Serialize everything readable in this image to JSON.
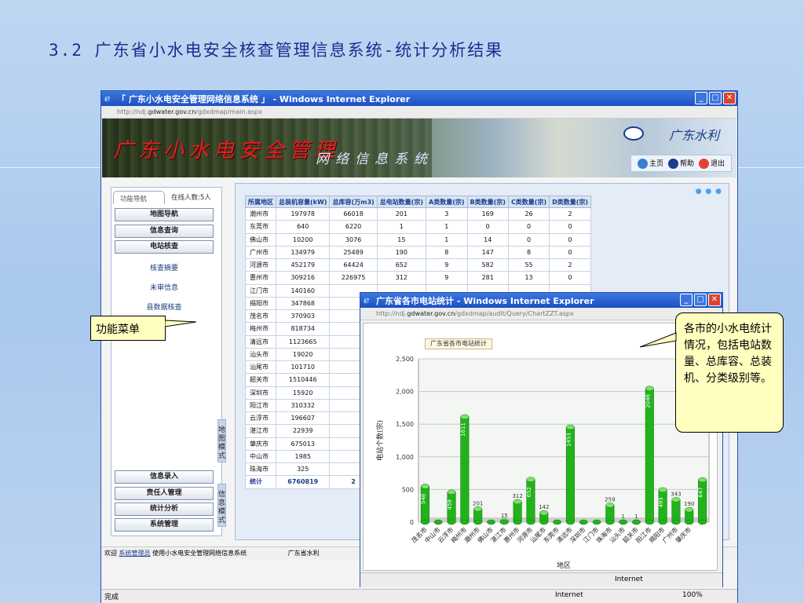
{
  "slide": {
    "title": "3.2 广东省小水电安全核查管理信息系统-统计分析结果"
  },
  "browser": {
    "title": "「 广东小水电安全管理网络信息系统 」 - Windows Internet Explorer",
    "url_prefix": "http://ndj.",
    "url_host": "gdwater.gov.cn",
    "url_path": "/gdxdmap/main.aspx",
    "status_left": "完成",
    "zone": "Internet",
    "zoom": "100%"
  },
  "banner": {
    "title": "广东小水电安全管理",
    "subtitle": "网络信息系统",
    "brand": "广东水利"
  },
  "topnav": {
    "home": "主页",
    "help": "帮助",
    "logout": "退出"
  },
  "sidebar": {
    "tab_nav": "功能导航",
    "online": "在线人数:5人",
    "top_buttons": [
      "地图导航",
      "信息查询",
      "电站核查"
    ],
    "sub_items": [
      "核查摘要",
      "未审信息",
      "县数据核查"
    ],
    "bottom_buttons": [
      "信息录入",
      "责任人管理",
      "统计分析",
      "系统管理"
    ],
    "vtab_map": "地图模式",
    "vtab_info": "信息模式"
  },
  "table": {
    "headers": [
      "所属地区",
      "总装机容量(kW)",
      "总库容(万m3)",
      "总电站数量(宗)",
      "A类数量(宗)",
      "B类数量(宗)",
      "C类数量(宗)",
      "D类数量(宗)"
    ],
    "rows": [
      [
        "潮州市",
        "197978",
        "66018",
        "201",
        "3",
        "169",
        "26",
        "2"
      ],
      [
        "东莞市",
        "640",
        "6220",
        "1",
        "1",
        "0",
        "0",
        "0"
      ],
      [
        "佛山市",
        "10200",
        "3076",
        "15",
        "1",
        "14",
        "0",
        "0"
      ],
      [
        "广州市",
        "134979",
        "25489",
        "190",
        "8",
        "147",
        "8",
        "0"
      ],
      [
        "河源市",
        "452179",
        "64424",
        "652",
        "9",
        "582",
        "55",
        "2"
      ],
      [
        "惠州市",
        "309216",
        "226975",
        "312",
        "9",
        "281",
        "13",
        "0"
      ],
      [
        "江门市",
        "140160",
        "",
        "",
        "",
        "",
        "",
        ""
      ],
      [
        "揭阳市",
        "347868",
        "",
        "",
        "",
        "",
        "",
        ""
      ],
      [
        "茂名市",
        "370903",
        "",
        "",
        "",
        "",
        "",
        ""
      ],
      [
        "梅州市",
        "818734",
        "",
        "",
        "",
        "",
        "",
        ""
      ],
      [
        "清远市",
        "1123665",
        "",
        "",
        "",
        "",
        "",
        ""
      ],
      [
        "汕头市",
        "19020",
        "",
        "",
        "",
        "",
        "",
        ""
      ],
      [
        "汕尾市",
        "101710",
        "",
        "",
        "",
        "",
        "",
        ""
      ],
      [
        "韶关市",
        "1510446",
        "",
        "",
        "",
        "",
        "",
        ""
      ],
      [
        "深圳市",
        "15920",
        "",
        "",
        "",
        "",
        "",
        ""
      ],
      [
        "阳江市",
        "310332",
        "",
        "",
        "",
        "",
        "",
        ""
      ],
      [
        "云浮市",
        "196607",
        "",
        "",
        "",
        "",
        "",
        ""
      ],
      [
        "湛江市",
        "22939",
        "",
        "",
        "",
        "",
        "",
        ""
      ],
      [
        "肇庆市",
        "675013",
        "",
        "",
        "",
        "",
        "",
        ""
      ],
      [
        "中山市",
        "1985",
        "",
        "",
        "",
        "",
        "",
        ""
      ],
      [
        "珠海市",
        "325",
        "",
        "",
        "",
        "",
        "",
        ""
      ]
    ],
    "total": [
      "统计",
      "6760819",
      "2",
      "",
      "",
      "",
      "",
      ""
    ]
  },
  "footer": {
    "welcome": "欢迎",
    "user": "系统管理员",
    "message": "使用小水电安全管理网络信息系统",
    "org": "广东省水利"
  },
  "popup": {
    "title": "广东省各市电站统计 - Windows Internet Explorer",
    "url_prefix": "http://ndj.",
    "url_host": "gdwater.gov.cn",
    "url_path": "/gdxdmap/audit/Query/ChartZZT.aspx",
    "chart_tab": "广东省各市电站统计",
    "zone": "Internet"
  },
  "callouts": {
    "left": "功能菜单",
    "right": "各市的小水电统计情况，包括电站数量、总库容、总装机、分类级别等。"
  },
  "chart_data": {
    "type": "bar",
    "title": "广东省各市电站统计",
    "xlabel": "地区",
    "ylabel": "电站个数(宗)",
    "ylim": [
      0,
      2500
    ],
    "yticks": [
      0,
      500,
      1000,
      1500,
      2000,
      2500
    ],
    "categories": [
      "茂名市",
      "中山市",
      "云浮市",
      "梅州市",
      "潮州市",
      "佛山市",
      "湛江市",
      "惠州市",
      "河源市",
      "汕尾市",
      "东莞市",
      "清远市",
      "深圳市",
      "江门市",
      "珠海市",
      "汕头市",
      "韶关市",
      "阳江市",
      "揭阳市",
      "广州市",
      "肇庆市"
    ],
    "values": [
      548,
      0,
      459,
      1611,
      201,
      0,
      15,
      312,
      652,
      142,
      0,
      1453,
      0,
      0,
      259,
      1,
      1,
      2046,
      493,
      343,
      190,
      647
    ],
    "labels": [
      "548",
      "",
      "459",
      "1611",
      "201",
      "",
      "15",
      "312",
      "652",
      "142",
      "",
      "1453",
      "",
      "",
      "259",
      "1",
      "1",
      "2046",
      "493",
      "343",
      "190",
      "647"
    ],
    "bar_color": "#22b31c",
    "grid": true
  }
}
